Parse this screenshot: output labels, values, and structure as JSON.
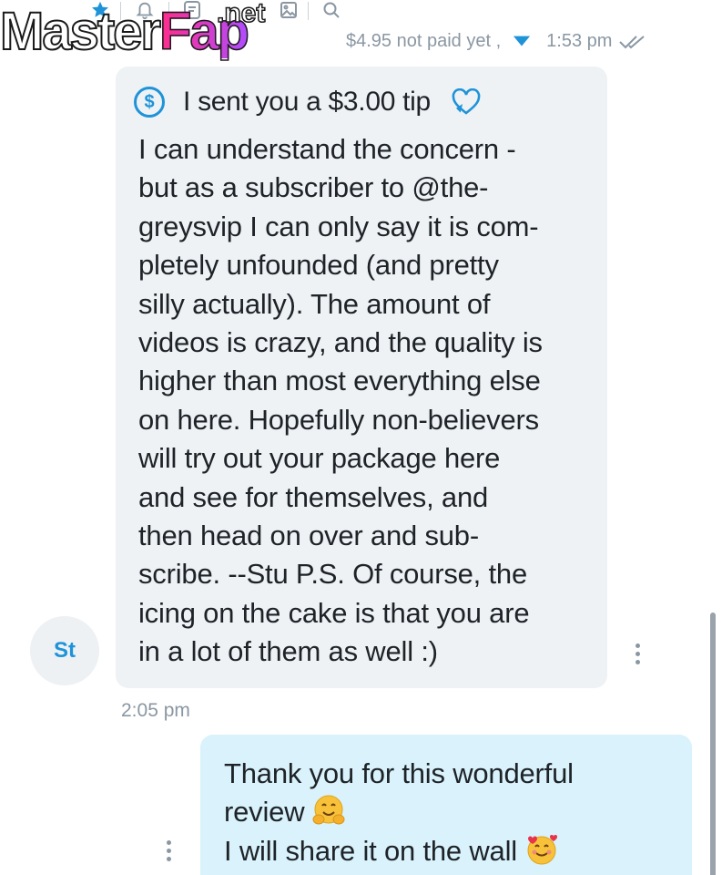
{
  "watermark": {
    "text_main": "Master",
    "text_accent": "Fap",
    "text_suffix": ".net"
  },
  "toolbar": {
    "icons": [
      "star-icon",
      "bell-icon",
      "document-icon",
      "image-icon",
      "search-icon"
    ]
  },
  "status": {
    "amount_text": "$4.95 not paid yet ,",
    "time": "1:53 pm"
  },
  "incoming": {
    "avatar_initials": "St",
    "tip_text": "I sent you a $3.00 tip",
    "lines": [
      "I can understand the concern -",
      "but as a subscriber to @the-",
      "greysvip I can only say it is com-",
      "pletely unfounded (and pretty",
      "silly actually). The amount of",
      "videos is crazy, and the quality is",
      "higher than most everything else",
      "on here. Hopefully non-believers",
      "will try out your package here",
      "and see for themselves, and",
      "then head on over and sub-",
      "scribe. --Stu P.S. Of course, the",
      "icing on the cake is that you are",
      "in a lot of them as well :)"
    ],
    "time": "2:05 pm"
  },
  "outgoing": {
    "lines": [
      "Thank you for this wonderful",
      "review",
      "I will share it on the wall"
    ],
    "emoji": [
      "hugging-face-emoji",
      "smiling-face-with-hearts-emoji"
    ]
  },
  "colors": {
    "accent": "#1f93d8",
    "incoming_bubble": "#eef2f5",
    "outgoing_bubble": "#d9f2fb",
    "muted": "#8a97a3"
  }
}
